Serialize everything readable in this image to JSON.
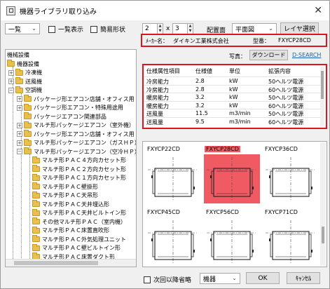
{
  "window": {
    "title": "機器ライブラリ取り込み",
    "close": "✕"
  },
  "toolbar": {
    "category": "一覧",
    "list_view_label": "一覧表示",
    "simple_shape_label": "簡易形状",
    "rows": "2",
    "times": "x",
    "cols": "3",
    "placement_label": "配置面",
    "placement_value": "平面図",
    "layer_button": "レイヤ選択"
  },
  "info": {
    "maker_label": "ﾒｰｶｰ名：",
    "maker_value": "ダイキン工業株式会社",
    "model_label": "型番：",
    "model_value": "FXYCP28CD"
  },
  "photo": {
    "label": "写真：",
    "download": "ダウンロード",
    "link": "D-SEARCH"
  },
  "tree": {
    "items": [
      {
        "label": "機械設備",
        "level": 0,
        "exp": "",
        "folder": false
      },
      {
        "label": "機器設備",
        "level": 0,
        "exp": "",
        "folder": true
      },
      {
        "label": "冷凍機",
        "level": 1,
        "exp": "+",
        "folder": true
      },
      {
        "label": "送風機",
        "level": 1,
        "exp": "+",
        "folder": true
      },
      {
        "label": "空調機",
        "level": 1,
        "exp": "−",
        "folder": true
      },
      {
        "label": "パッケージ形エアコン店舗・オフィス用（空冷",
        "level": 2,
        "exp": "+",
        "folder": true
      },
      {
        "label": "パッケージ形エアコン・特殊用途用",
        "level": 2,
        "exp": "+",
        "folder": true
      },
      {
        "label": "パッケージエアコン関連部品",
        "level": 2,
        "exp": "",
        "folder": true
      },
      {
        "label": "マルチ形パッケージエアコン（室外機）",
        "level": 2,
        "exp": "+",
        "folder": true
      },
      {
        "label": "パッケージ形エアコン店舗・オフィス用（水冷",
        "level": 2,
        "exp": "+",
        "folder": true
      },
      {
        "label": "マルチ形パッケージエアコン（ガスＨＰ）",
        "level": 2,
        "exp": "+",
        "folder": true
      },
      {
        "label": "マルチ形パッケージエアコン（空冷ＨＰ）",
        "level": 2,
        "exp": "−",
        "folder": true
      },
      {
        "label": "マルチ形ＰＡＣ４方向カセット形",
        "level": 3,
        "exp": "",
        "folder": true
      },
      {
        "label": "マルチ形ＰＡＣ２方向カセット形",
        "level": 3,
        "exp": "",
        "folder": true
      },
      {
        "label": "マルチ形ＰＡＣ１方向カセット形",
        "level": 3,
        "exp": "",
        "folder": true
      },
      {
        "label": "マルチ形ＰＡＣ壁掛形",
        "level": 3,
        "exp": "",
        "folder": true
      },
      {
        "label": "マルチ形ＰＡＣ天吊形",
        "level": 3,
        "exp": "",
        "folder": true
      },
      {
        "label": "マルチ形ＰＡＣ天井埋込形",
        "level": 3,
        "exp": "",
        "folder": true
      },
      {
        "label": "マルチ形ＰＡＣ天井ビルトイン形",
        "level": 3,
        "exp": "",
        "folder": true
      },
      {
        "label": "その他マルチ形ＰＡＣ（室内機）",
        "level": 3,
        "exp": "",
        "folder": true
      },
      {
        "label": "マルチ形ＰＡＣ床置直吹形",
        "level": 3,
        "exp": "",
        "folder": true
      },
      {
        "label": "マルチ形ＰＡＣ外気処理ユニット",
        "level": 3,
        "exp": "",
        "folder": true
      },
      {
        "label": "マルチ形ＰＡＣ壁ビルトイン形",
        "level": 3,
        "exp": "",
        "folder": true
      },
      {
        "label": "マルチ形ＰＡＣ床置ダクト形",
        "level": 3,
        "exp": "",
        "folder": true
      }
    ]
  },
  "table": {
    "headers": [
      "仕様属性項目",
      "仕様値",
      "単位",
      "拡張内容"
    ],
    "rows": [
      [
        "冷房能力",
        "2.8",
        "kW",
        "50ヘルツ電源"
      ],
      [
        "冷房能力",
        "2.8",
        "kW",
        "60ヘルツ電源"
      ],
      [
        "暖房能力",
        "3.2",
        "kW",
        "50ヘルツ電源"
      ],
      [
        "暖房能力",
        "3.2",
        "kW",
        "60ヘルツ電源"
      ],
      [
        "送風量",
        "11.5",
        "m3/min",
        "50ヘルツ電源"
      ],
      [
        "送風量",
        "9.5",
        "m3/min",
        "60ヘルツ電源"
      ]
    ]
  },
  "gallery": {
    "selected_index": 1,
    "items": [
      "FXYCP22CD",
      "FXYCP28CD",
      "FXYCP36CD",
      "FXYCP45CD",
      "FXYCP56CD",
      "FXYCP71CD"
    ]
  },
  "footer": {
    "skip_next_label": "次回以降省略",
    "equipment_value": "機器",
    "ok": "OK",
    "cancel": "ｷｬﾝｾﾙ"
  },
  "colors": {
    "highlight": "#e0141e",
    "selected_fill": "#ef5a63",
    "link": "#1a5fb4",
    "folder": "#e7c04f"
  }
}
